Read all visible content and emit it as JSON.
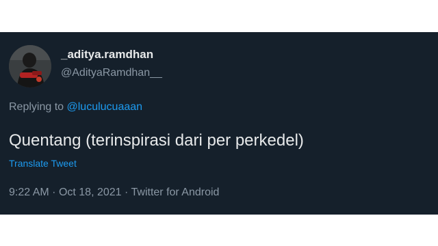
{
  "tweet": {
    "display_name": "_aditya.ramdhan",
    "handle": "@AdityaRamdhan__",
    "replying_prefix": "Replying to",
    "replying_to": "@luculucuaaan",
    "text": "Quentang (terinspirasi dari per perkedel)",
    "translate_label": "Translate Tweet",
    "time": "9:22 AM",
    "separator": "·",
    "date": "Oct 18, 2021",
    "source": "Twitter for Android"
  },
  "colors": {
    "card_background": "#15202b",
    "primary_text": "#e7e9ea",
    "secondary_text": "#8b98a5",
    "accent": "#1d9bf0"
  },
  "icons": {
    "avatar": "user-avatar-photo"
  }
}
